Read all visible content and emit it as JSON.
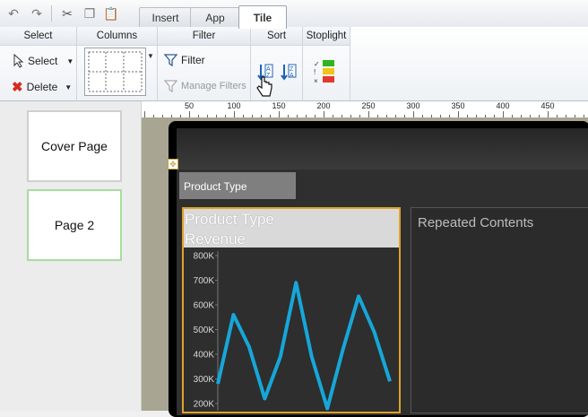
{
  "toolbar": {
    "tabs": [
      {
        "label": "Insert",
        "active": false
      },
      {
        "label": "App",
        "active": false
      },
      {
        "label": "Tile",
        "active": true
      }
    ],
    "quick_icons": [
      "undo-icon",
      "redo-icon",
      "cut-icon",
      "copy-icon",
      "paste-icon"
    ]
  },
  "ribbon": {
    "select": {
      "title": "Select",
      "select_label": "Select",
      "delete_label": "Delete"
    },
    "columns": {
      "title": "Columns"
    },
    "filter": {
      "title": "Filter",
      "filter_label": "Filter",
      "manage_label": "Manage Filters"
    },
    "sort": {
      "title": "Sort"
    },
    "stoplight": {
      "title": "Stoplight",
      "colors": [
        "#2db41e",
        "#f2c318",
        "#e23a2e"
      ]
    }
  },
  "pages": [
    {
      "label": "Cover Page",
      "selected": false
    },
    {
      "label": "Page 2",
      "selected": true
    }
  ],
  "ruler": {
    "labels": [
      "50",
      "100",
      "150",
      "200",
      "250",
      "300",
      "350",
      "400",
      "450"
    ]
  },
  "dashboard": {
    "prompt_label": "Product Type",
    "tile_title": "Product Type",
    "tile_subtitle": "Revenue",
    "repeated_label": "Repeated Contents"
  },
  "chart_data": {
    "type": "line",
    "y_tick_labels": [
      "800K",
      "700K",
      "600K",
      "500K",
      "400K",
      "300K",
      "200K"
    ],
    "ylim": [
      200000,
      800000
    ],
    "series": [
      {
        "color": "#16a7d8",
        "values": [
          280000,
          560000,
          430000,
          220000,
          390000,
          690000,
          390000,
          180000,
          420000,
          635000,
          490000,
          290000
        ]
      }
    ],
    "grid": false
  }
}
